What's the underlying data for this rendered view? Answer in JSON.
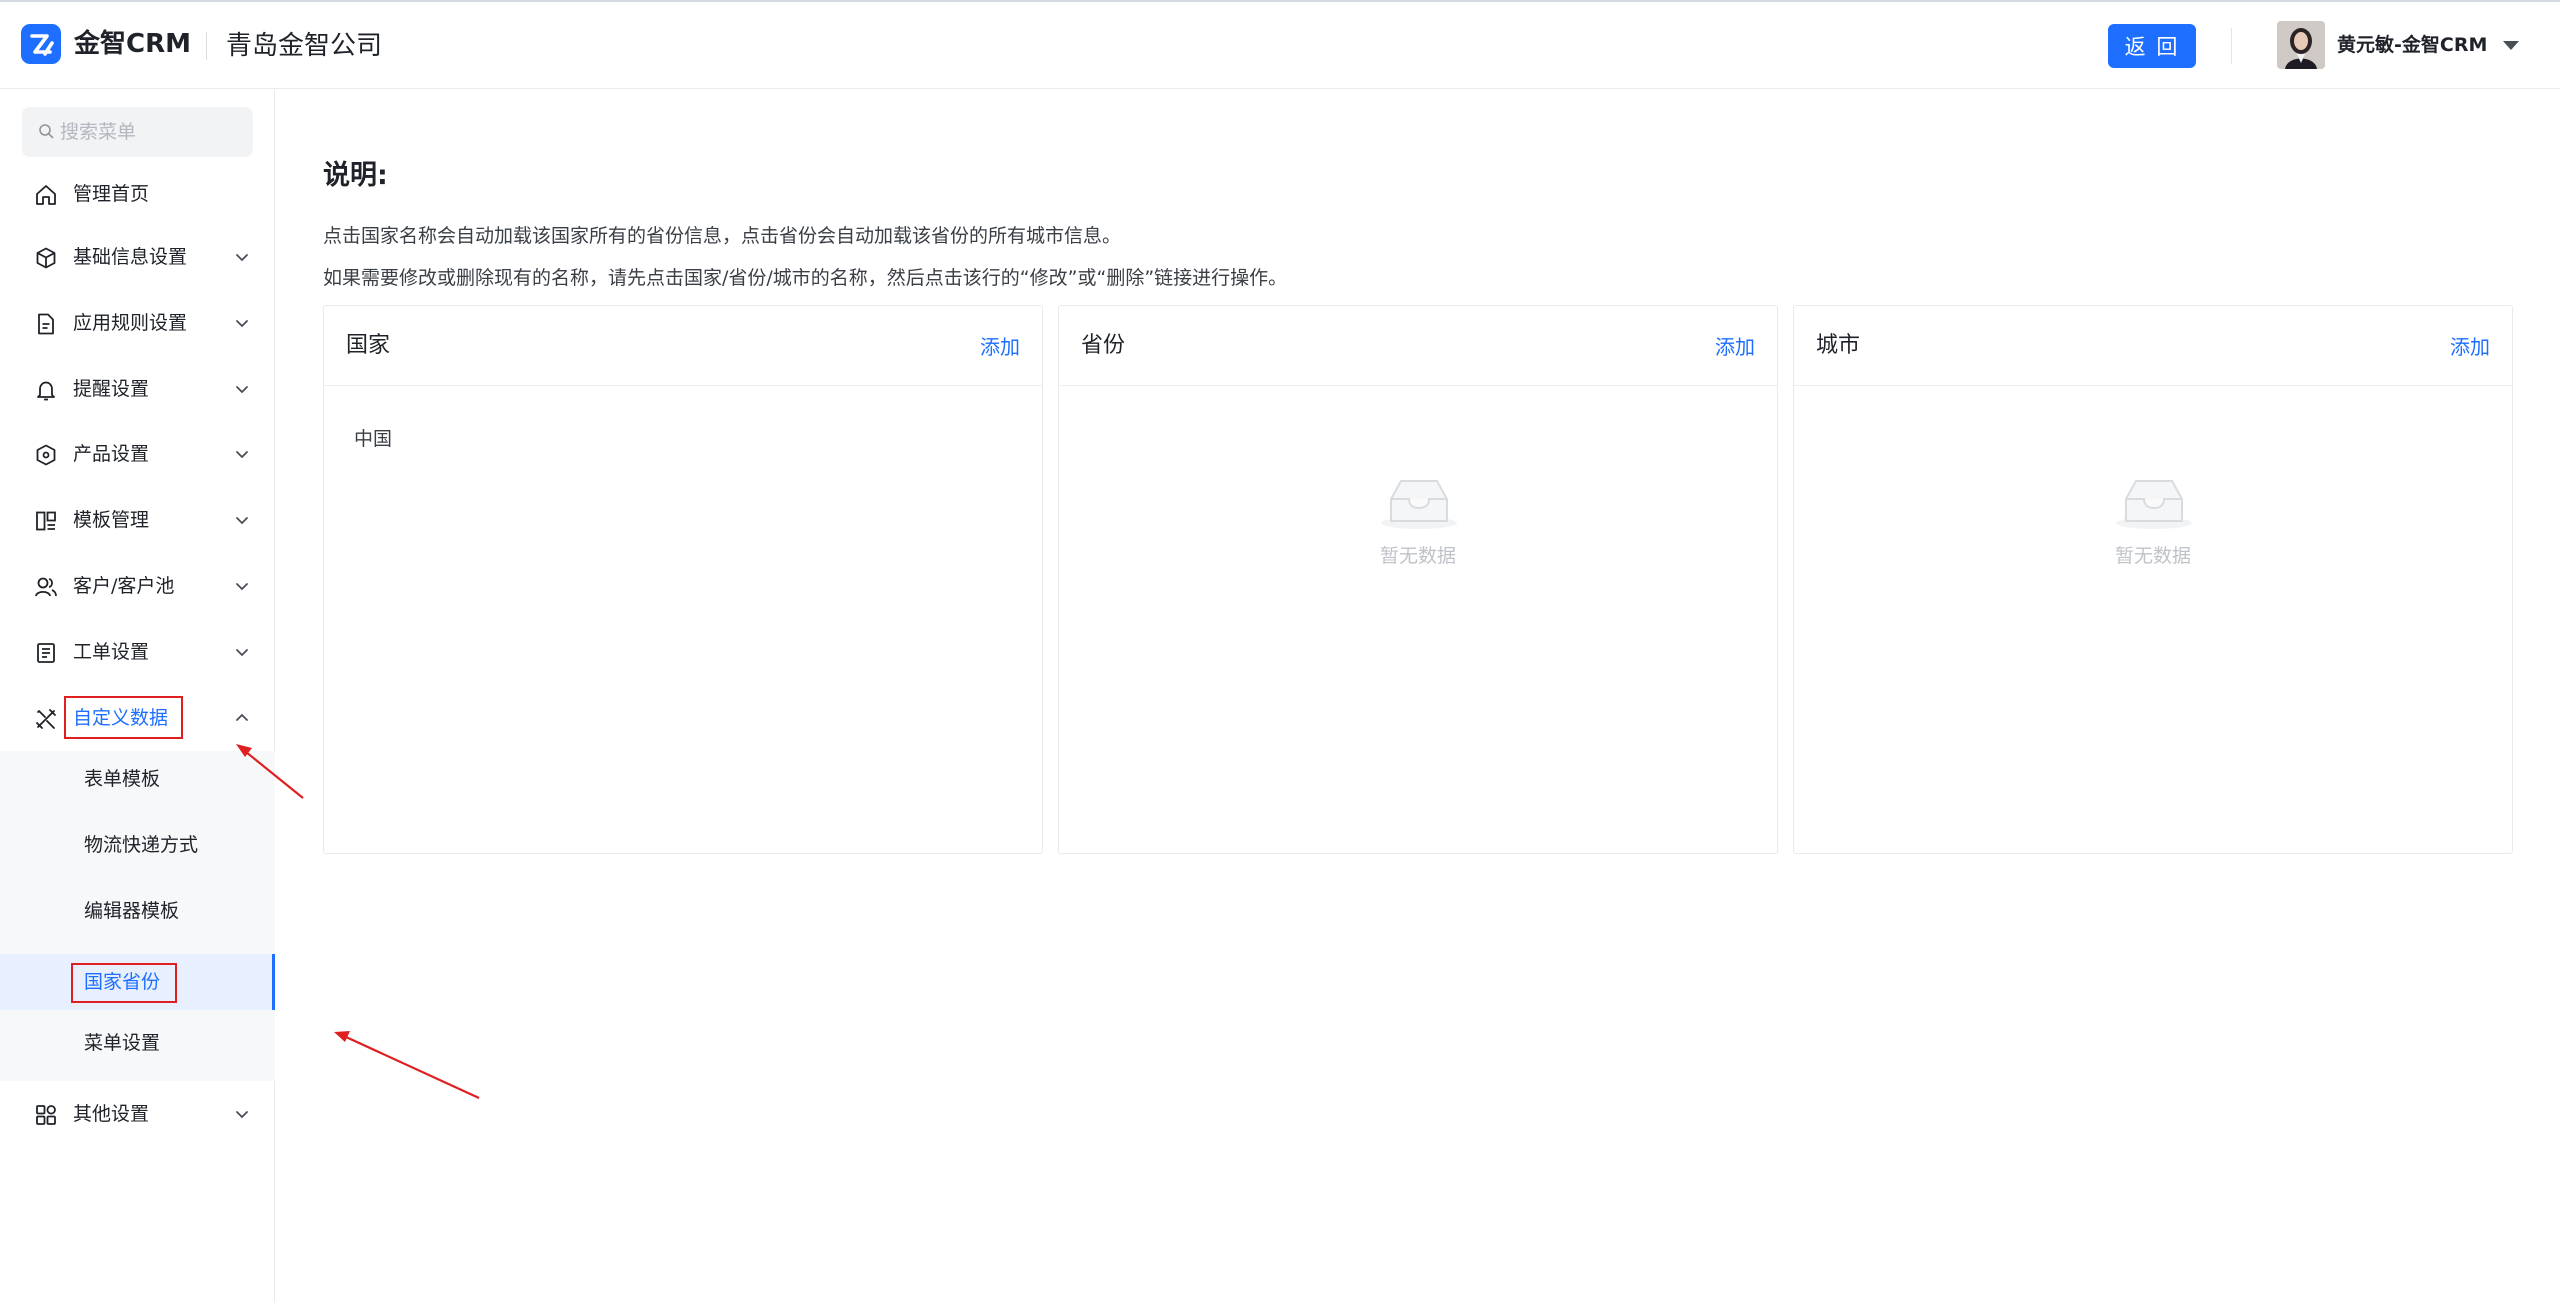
{
  "header": {
    "app_name": "金智CRM",
    "company": "青岛金智公司",
    "back_label": "返 回",
    "username": "黄元敏-金智CRM"
  },
  "sidebar": {
    "search_placeholder": "搜索菜单",
    "items": [
      {
        "label": "管理首页",
        "icon": "home-icon"
      },
      {
        "label": "基础信息设置",
        "icon": "cube-icon"
      },
      {
        "label": "应用规则设置",
        "icon": "document-icon"
      },
      {
        "label": "提醒设置",
        "icon": "bell-icon"
      },
      {
        "label": "产品设置",
        "icon": "box-icon"
      },
      {
        "label": "模板管理",
        "icon": "template-icon"
      },
      {
        "label": "客户/客户池",
        "icon": "users-icon"
      },
      {
        "label": "工单设置",
        "icon": "ticket-icon"
      },
      {
        "label": "自定义数据",
        "icon": "tools-icon"
      },
      {
        "label": "其他设置",
        "icon": "grid-icon"
      }
    ],
    "sub_items": [
      {
        "label": "表单模板"
      },
      {
        "label": "物流快递方式"
      },
      {
        "label": "编辑器模板"
      },
      {
        "label": "国家省份"
      },
      {
        "label": "菜单设置"
      }
    ]
  },
  "main": {
    "title": "说明:",
    "desc_line1": "点击国家名称会自动加载该国家所有的省份信息，点击省份会自动加载该省份的所有城市信息。",
    "desc_line2": "如果需要修改或删除现有的名称，请先点击国家/省份/城市的名称，然后点击该行的“修改”或“删除”链接进行操作。",
    "panels": [
      {
        "title": "国家",
        "add": "添加",
        "rows": [
          "中国"
        ]
      },
      {
        "title": "省份",
        "add": "添加",
        "empty": "暂无数据"
      },
      {
        "title": "城市",
        "add": "添加",
        "empty": "暂无数据"
      }
    ]
  },
  "colors": {
    "accent": "#1e6fff",
    "annotation_red": "#e02020"
  }
}
